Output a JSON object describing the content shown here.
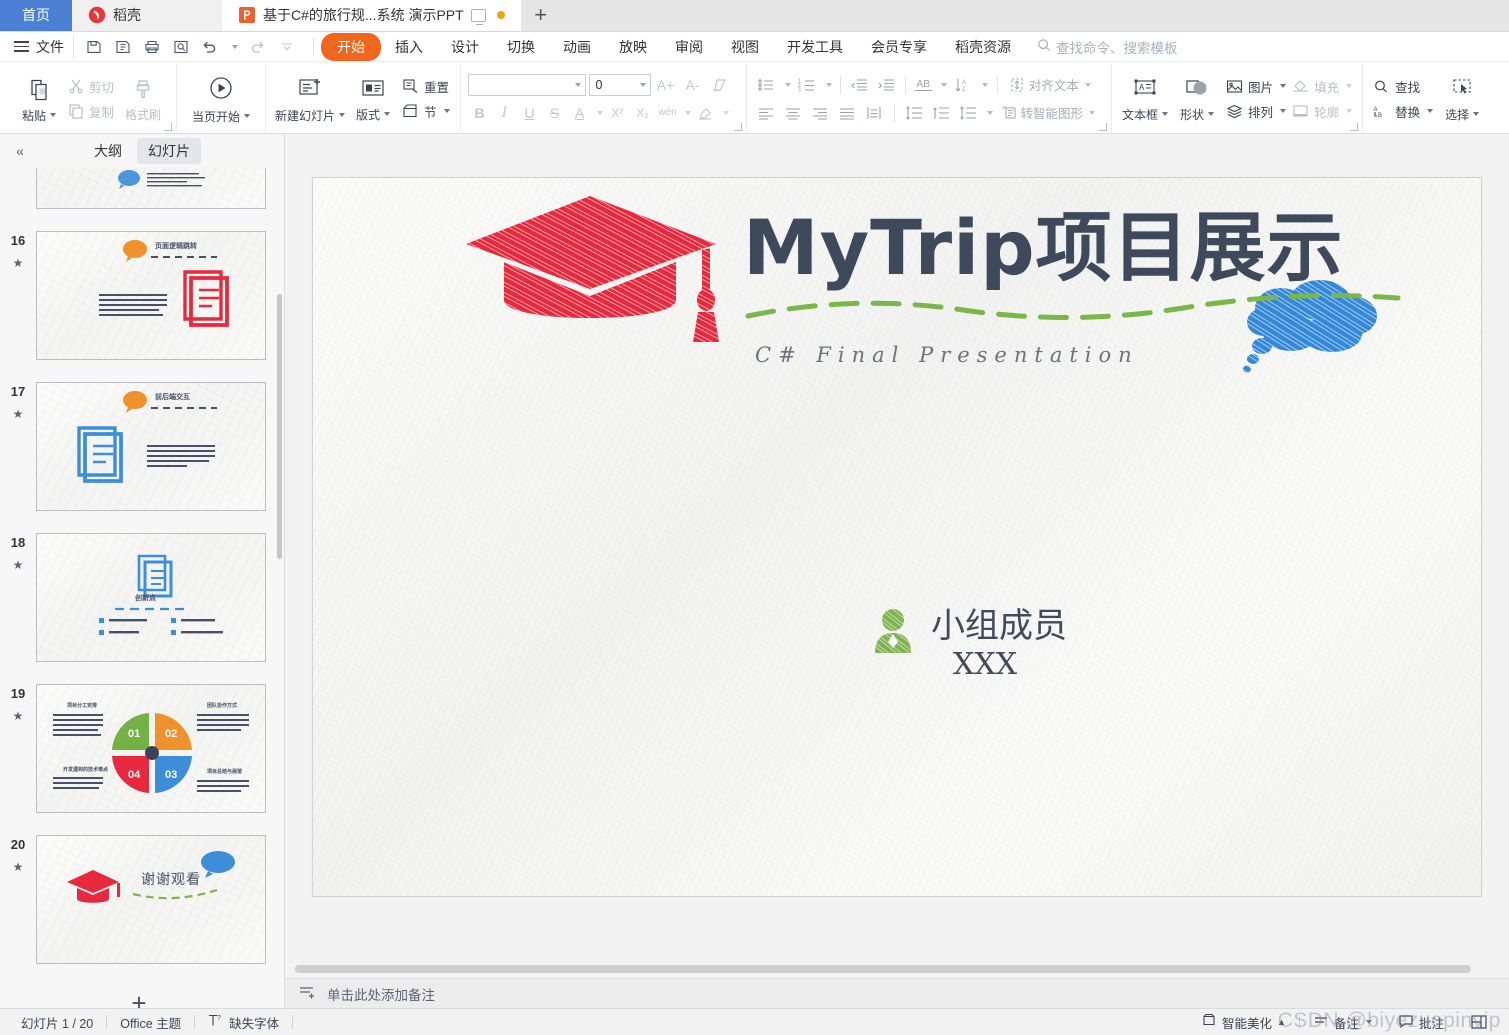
{
  "window": {
    "tabs": [
      {
        "id": "home",
        "label": "首页",
        "icon": "home-tab"
      },
      {
        "id": "docer",
        "label": "稻壳",
        "icon": "docer-logo-icon"
      },
      {
        "id": "doc1",
        "label": "基于C#的旅行规...系统 演示PPT",
        "icon": "powerpoint-file-icon",
        "unsaved": true,
        "present": true
      }
    ],
    "add_tab_label": "+"
  },
  "menubar": {
    "file_label": "文件",
    "quick_access": [
      "save-icon",
      "save-as-icon",
      "print-icon",
      "print-preview-icon",
      "undo-icon",
      "redo-icon",
      "customize-qat-icon"
    ],
    "items": [
      {
        "label": "开始",
        "selected": true
      },
      {
        "label": "插入",
        "selected": false
      },
      {
        "label": "设计",
        "selected": false
      },
      {
        "label": "切换",
        "selected": false
      },
      {
        "label": "动画",
        "selected": false
      },
      {
        "label": "放映",
        "selected": false
      },
      {
        "label": "审阅",
        "selected": false
      },
      {
        "label": "视图",
        "selected": false
      },
      {
        "label": "开发工具",
        "selected": false
      },
      {
        "label": "会员专享",
        "selected": false
      },
      {
        "label": "稻壳资源",
        "selected": false
      }
    ],
    "search_placeholder": "查找命令、搜索模板"
  },
  "ribbon": {
    "clipboard": {
      "paste": "粘贴",
      "cut": "剪切",
      "copy": "复制",
      "format_painter": "格式刷"
    },
    "slideshow": {
      "from_current": "当页开始"
    },
    "slides": {
      "new_slide": "新建幻灯片",
      "layout": "版式",
      "reset": "重置",
      "section": "节"
    },
    "font": {
      "name_value": "",
      "size_value": "0",
      "grow": "A+",
      "shrink": "A-",
      "clear_format": "clear-format-icon",
      "bold": "B",
      "italic": "I",
      "underline": "U",
      "strikethrough": "S",
      "font_color": "A",
      "superscript": "X²",
      "subscript": "X₂",
      "pinyin": "wén",
      "highlight": "highlight-icon"
    },
    "paragraph": {
      "bullets": "bullet-list-icon",
      "numbering": "numbered-list-icon",
      "decrease_indent": "decrease-indent-icon",
      "increase_indent": "increase-indent-icon",
      "text_direction": "AB",
      "sort": "sort-icon",
      "align_text": "对齐文本",
      "align_left": "align-left-icon",
      "align_center": "align-center-icon",
      "align_right": "align-right-icon",
      "justify": "justify-icon",
      "distribute": "distribute-icon",
      "line_spacing": "line-spacing-icon",
      "space_before": "space-before-icon",
      "space_paragraph": "paragraph-spacing-icon",
      "convert_smartart": "转智能图形"
    },
    "drawing": {
      "textbox": "文本框",
      "shape": "形状",
      "picture": "图片",
      "arrange": "排列",
      "fill": "填充",
      "outline": "轮廓"
    },
    "editing": {
      "find": "查找",
      "replace": "替换",
      "select": "选择"
    }
  },
  "sidebar": {
    "collapse_icon": "collapse-chevron-icon",
    "tabs": [
      {
        "label": "大纲",
        "selected": false
      },
      {
        "label": "幻灯片",
        "selected": true
      }
    ],
    "slides": [
      {
        "number": "15",
        "star": "★",
        "kind": "partial"
      },
      {
        "number": "16",
        "star": "★",
        "kind": "doc-red",
        "title": "页面逻辑跳转"
      },
      {
        "number": "17",
        "star": "★",
        "kind": "doc-blue",
        "title": "前后端交互"
      },
      {
        "number": "18",
        "star": "★",
        "kind": "innovation",
        "title": "创新点",
        "bullets": [
          "前后端分离架构",
          "自适应页面布局",
          "图形化界面",
          "调用高德Web API"
        ]
      },
      {
        "number": "19",
        "star": "★",
        "kind": "pie",
        "segments": [
          "01",
          "02",
          "03",
          "04"
        ]
      },
      {
        "number": "20",
        "star": "★",
        "kind": "thanks",
        "title": "谢谢观看"
      }
    ],
    "add_slide_label": "+"
  },
  "slide": {
    "title": "MyTrip项目展示",
    "subtitle": "C# Final Presentation",
    "member_label": "小组成员",
    "member_name": "XXX",
    "cap_icon": "graduation-cap-icon",
    "cloud_icon": "thought-bubble-icon",
    "person_icon": "person-icon",
    "colors": {
      "cap_red": "#e8283c",
      "cloud_blue": "#3388d8",
      "title_navy": "#3d4a5c",
      "squiggle_green": "#7ab648",
      "person_green": "#7fb550"
    }
  },
  "notes": {
    "placeholder": "单击此处添加备注",
    "icon": "add-notes-icon"
  },
  "statusbar": {
    "slide_count": "幻灯片 1 / 20",
    "theme": "Office 主题",
    "missing_font": "缺失字体",
    "smart_beautify": "智能美化",
    "notes": "备注",
    "comments": "批注",
    "view_icon": "view-layout-icon"
  },
  "watermark": "CSDN @biyezuopinvip"
}
